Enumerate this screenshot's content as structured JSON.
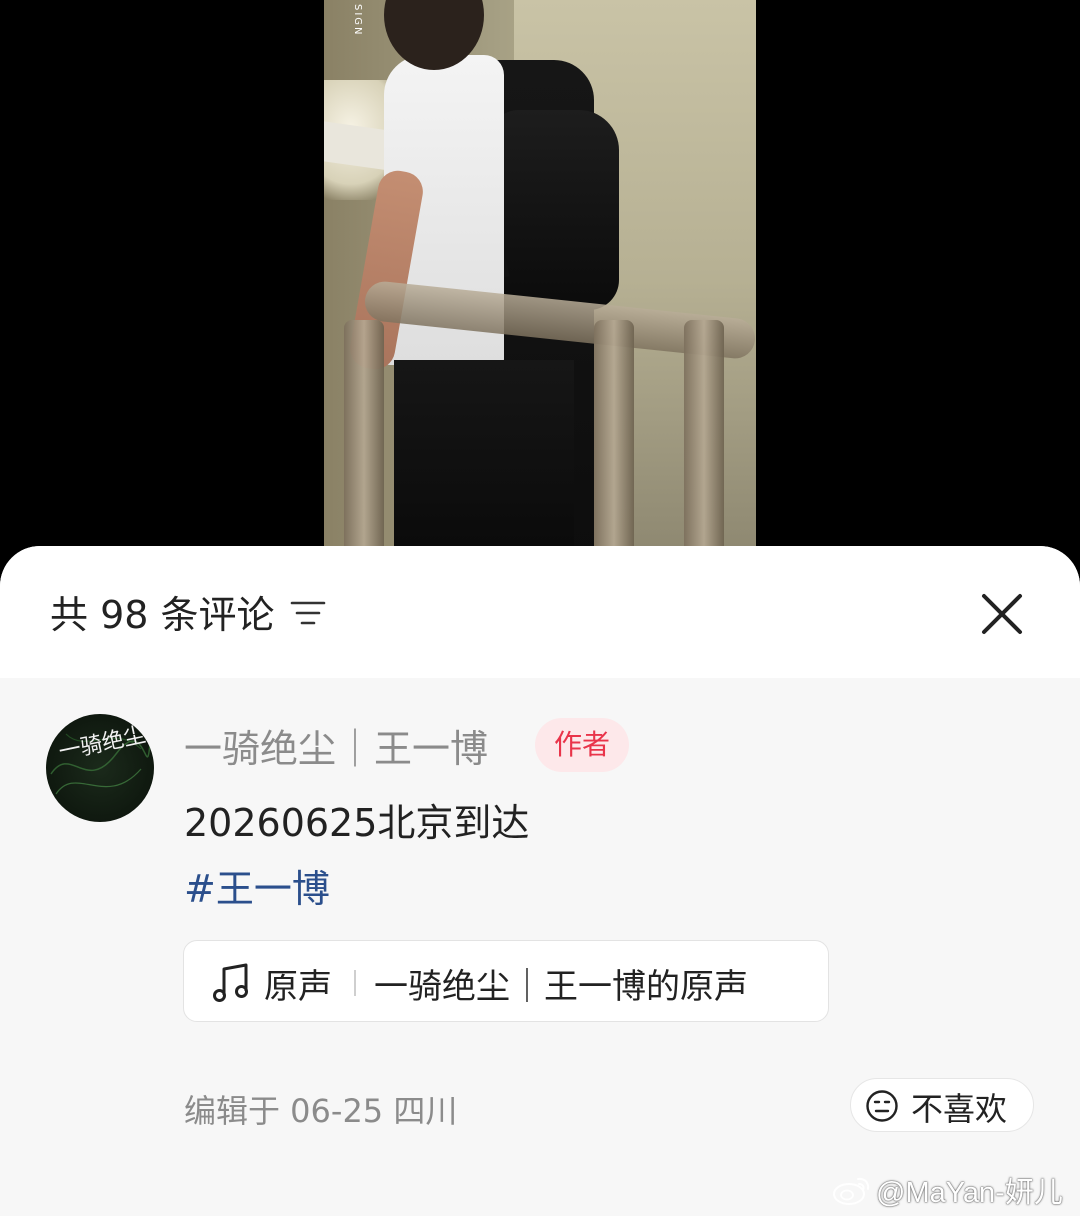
{
  "video": {
    "watermark": "SIGN"
  },
  "comments_sheet": {
    "count_label": "共 98 条评论",
    "sort_icon": "filter-lines-icon",
    "close_icon": "close-x-icon"
  },
  "comment": {
    "avatar_text": "一骑绝尘",
    "username": "一骑绝尘｜王一博",
    "author_badge": "作者",
    "text": "20260625北京到达",
    "hashtag": "#王一博",
    "music": {
      "icon": "music-note-icon",
      "label": "原声",
      "title": "一骑绝尘｜王一博的原声"
    },
    "meta": "编辑于 06-25 四川",
    "dislike": {
      "icon": "unhappy-face-icon",
      "label": "不喜欢"
    }
  },
  "watermark": {
    "icon": "weibo-icon",
    "text": "@MaYan-妍儿"
  },
  "colors": {
    "author_badge_text": "#e9344a",
    "author_badge_bg": "#fde8ea",
    "hashtag": "#2b4f8c",
    "sheet_bg": "#f7f7f7"
  }
}
